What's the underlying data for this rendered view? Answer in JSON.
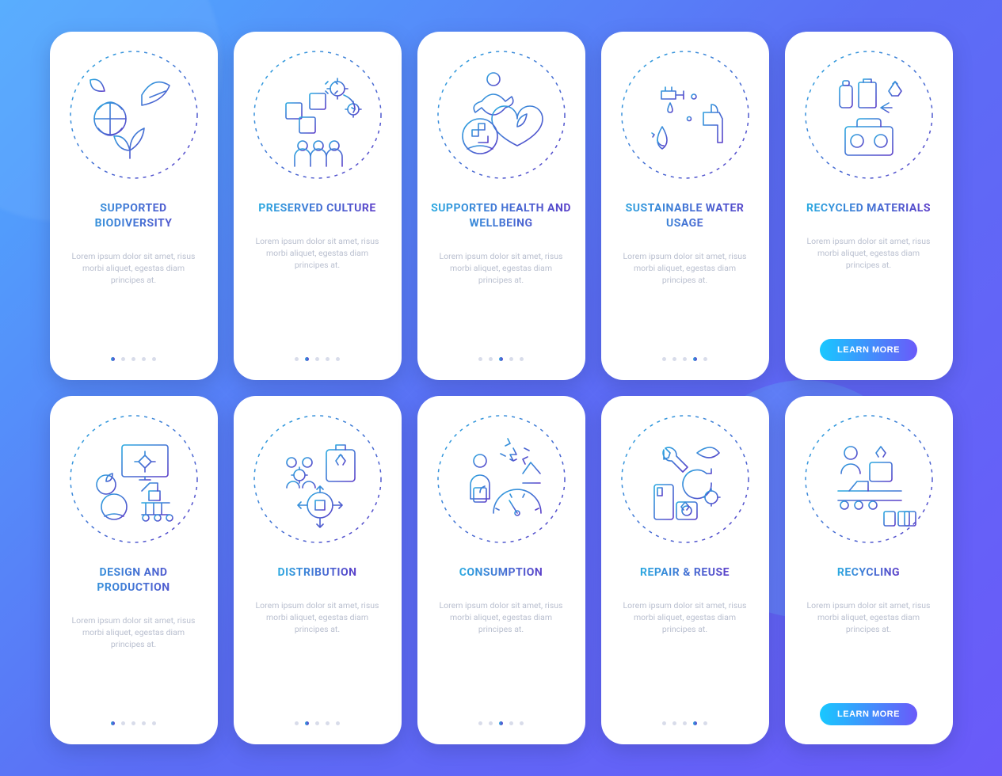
{
  "colors": {
    "grad_start": "#2aa9e0",
    "grad_end": "#5b3fc9"
  },
  "lorem": "Lorem ipsum dolor sit amet, risus morbi aliquet, egestas diam principes at.",
  "button_label": "LEARN MORE",
  "pager": {
    "total": 5
  },
  "cards": [
    {
      "title": "SUPPORTED BIODIVERSITY",
      "icon": "biodiversity-icon",
      "active_dot": 0,
      "has_button": false
    },
    {
      "title": "PRESERVED CULTURE",
      "icon": "culture-icon",
      "active_dot": 1,
      "has_button": false
    },
    {
      "title": "SUPPORTED HEALTH AND WELLBEING",
      "icon": "health-wellbeing-icon",
      "active_dot": 2,
      "has_button": false
    },
    {
      "title": "SUSTAINABLE WATER USAGE",
      "icon": "water-usage-icon",
      "active_dot": 3,
      "has_button": false
    },
    {
      "title": "RECYCLED MATERIALS",
      "icon": "recycled-materials-icon",
      "active_dot": 4,
      "has_button": true
    },
    {
      "title": "DESIGN AND PRODUCTION",
      "icon": "design-production-icon",
      "active_dot": 0,
      "has_button": false
    },
    {
      "title": "DISTRIBUTION",
      "icon": "distribution-icon",
      "active_dot": 1,
      "has_button": false
    },
    {
      "title": "CONSUMPTION",
      "icon": "consumption-icon",
      "active_dot": 2,
      "has_button": false
    },
    {
      "title": "REPAIR & REUSE",
      "icon": "repair-reuse-icon",
      "active_dot": 3,
      "has_button": false
    },
    {
      "title": "RECYCLING",
      "icon": "recycling-icon",
      "active_dot": 4,
      "has_button": true
    }
  ]
}
